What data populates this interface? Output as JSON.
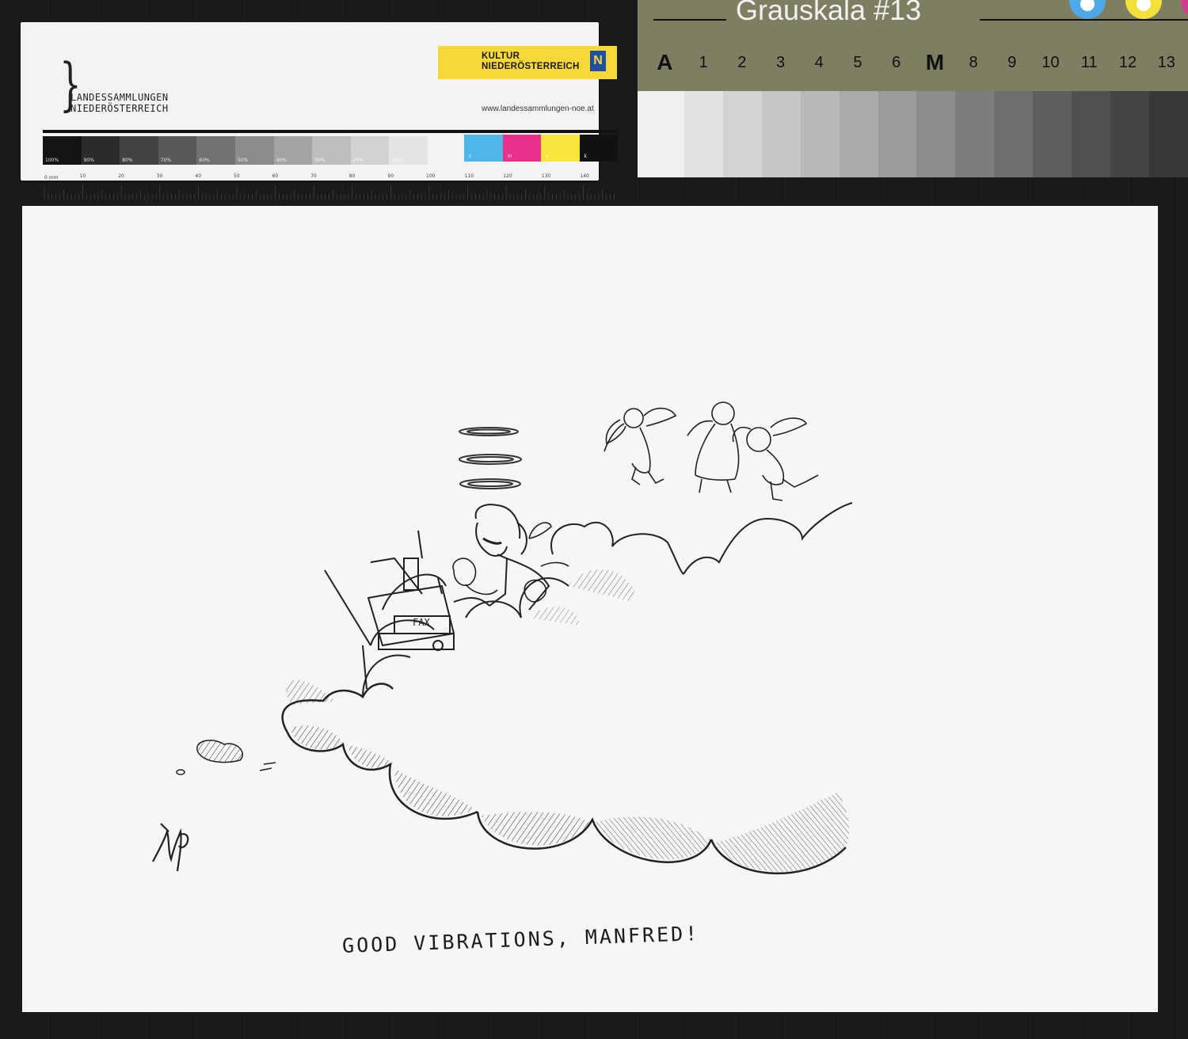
{
  "target_card": {
    "org_name_line1": "LANDESSAMMLUNGEN",
    "org_name_line2": "NIEDERÖSTERREICH",
    "sponsor_line1": "KULTUR",
    "sponsor_line2": "NIEDERÖSTERREICH",
    "sponsor_logo_letter": "N",
    "url": "www.landessammlungen-noe.at",
    "gray_patches": [
      {
        "label": "100%",
        "color": "#141414"
      },
      {
        "label": "90%",
        "color": "#2b2b2b"
      },
      {
        "label": "80%",
        "color": "#424242"
      },
      {
        "label": "70%",
        "color": "#595959"
      },
      {
        "label": "60%",
        "color": "#727272"
      },
      {
        "label": "50%",
        "color": "#8b8b8b"
      },
      {
        "label": "40%",
        "color": "#a3a3a3"
      },
      {
        "label": "30%",
        "color": "#bdbdbd"
      },
      {
        "label": "20%",
        "color": "#d2d2d2"
      },
      {
        "label": "10%",
        "color": "#e4e4e4"
      }
    ],
    "cmyk_patches": [
      {
        "label": "c",
        "color": "#4fb6e8"
      },
      {
        "label": "m",
        "color": "#e8318a"
      },
      {
        "label": "y",
        "color": "#f7e53b"
      },
      {
        "label": "k",
        "color": "#111111"
      }
    ],
    "ruler_unit": "0 mm",
    "ruler_labels": [
      "10",
      "20",
      "30",
      "40",
      "50",
      "60",
      "70",
      "80",
      "90",
      "100",
      "110",
      "120",
      "130",
      "140"
    ]
  },
  "grayscale_card": {
    "title": "Grauskala #13",
    "labels": [
      "A",
      "1",
      "2",
      "3",
      "4",
      "5",
      "6",
      "M",
      "8",
      "9",
      "10",
      "11",
      "12",
      "13"
    ],
    "step_colors": [
      "#efefed",
      "#e2e2e0",
      "#d3d3d1",
      "#c6c6c4",
      "#b8b8b6",
      "#aaaaa8",
      "#9b9b99",
      "#8c8c8a",
      "#7d7d7b",
      "#6e6e6c",
      "#5f5f5e",
      "#515150",
      "#444443",
      "#383837"
    ],
    "dot_colors": {
      "cyan": "#4ea9e6",
      "yellow": "#f4e03c",
      "magenta": "#d23a8a"
    }
  },
  "artwork": {
    "caption": "GOOD VIBRATIONS, MANFRED!",
    "fax_label": "FAX",
    "signature": "MP"
  }
}
